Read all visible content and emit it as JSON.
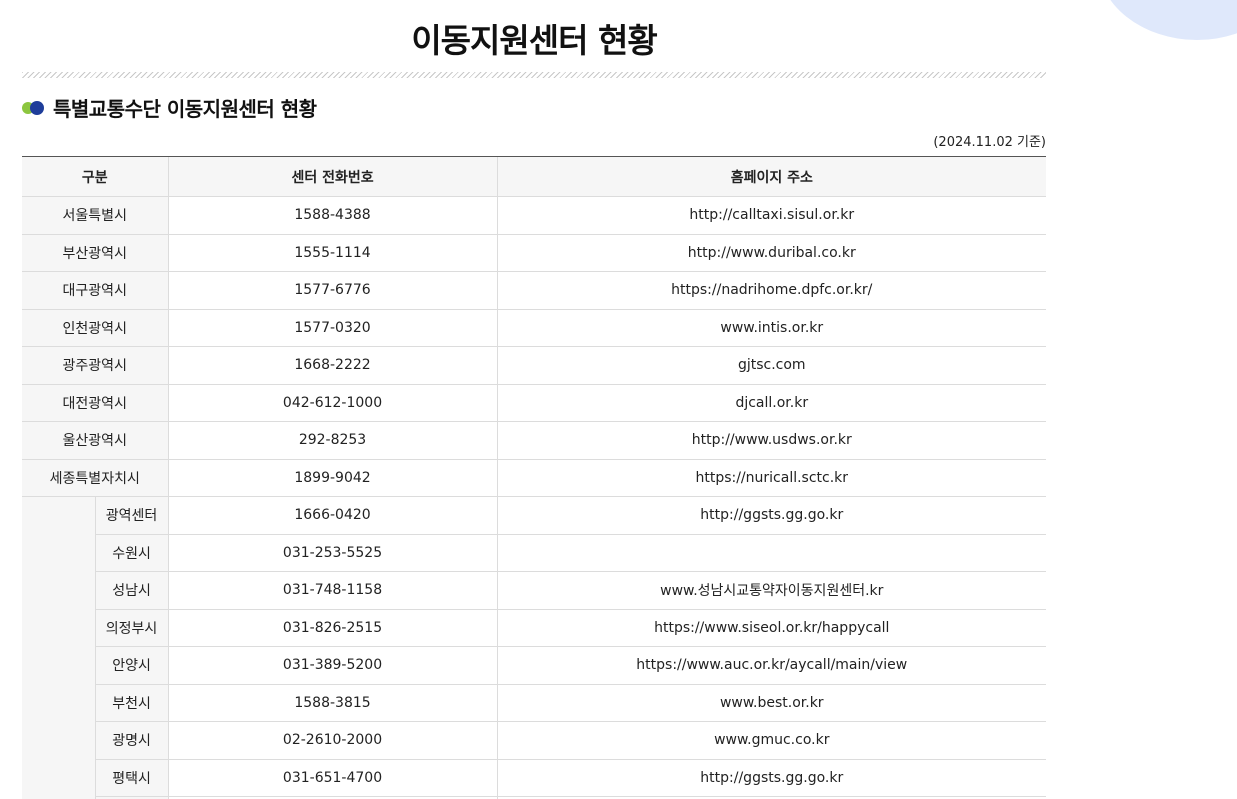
{
  "page_title": "이동지원센터 현황",
  "section_title": "특별교통수단 이동지원센터 현황",
  "date_note": "(2024.11.02 기준)",
  "table": {
    "headers": [
      "구분",
      "센터 전화번호",
      "홈페이지 주소"
    ],
    "rows": [
      {
        "region": "서울특별시",
        "phone": "1588-4388",
        "url": "http://calltaxi.sisul.or.kr"
      },
      {
        "region": "부산광역시",
        "phone": "1555-1114",
        "url": "http://www.duribal.co.kr"
      },
      {
        "region": "대구광역시",
        "phone": "1577-6776",
        "url": "https://nadrihome.dpfc.or.kr/"
      },
      {
        "region": "인천광역시",
        "phone": "1577-0320",
        "url": "www.intis.or.kr"
      },
      {
        "region": "광주광역시",
        "phone": "1668-2222",
        "url": "gjtsc.com"
      },
      {
        "region": "대전광역시",
        "phone": "042-612-1000",
        "url": "djcall.or.kr"
      },
      {
        "region": "울산광역시",
        "phone": "292-8253",
        "url": "http://www.usdws.or.kr"
      },
      {
        "region": "세종특별자치시",
        "phone": "1899-9042",
        "url": "https://nuricall.sctc.kr"
      }
    ],
    "sub_rows": [
      {
        "region": "광역센터",
        "phone": "1666-0420",
        "url": "http://ggsts.gg.go.kr"
      },
      {
        "region": "수원시",
        "phone": "031-253-5525",
        "url": ""
      },
      {
        "region": "성남시",
        "phone": "031-748-1158",
        "url": "www.성남시교통약자이동지원센터.kr"
      },
      {
        "region": "의정부시",
        "phone": "031-826-2515",
        "url": "https://www.siseol.or.kr/happycall"
      },
      {
        "region": "안양시",
        "phone": "031-389-5200",
        "url": "https://www.auc.or.kr/aycall/main/view"
      },
      {
        "region": "부천시",
        "phone": "1588-3815",
        "url": "www.best.or.kr"
      },
      {
        "region": "광명시",
        "phone": "02-2610-2000",
        "url": "www.gmuc.co.kr"
      },
      {
        "region": "평택시",
        "phone": "031-651-4700",
        "url": "http://ggsts.gg.go.kr"
      }
    ]
  }
}
